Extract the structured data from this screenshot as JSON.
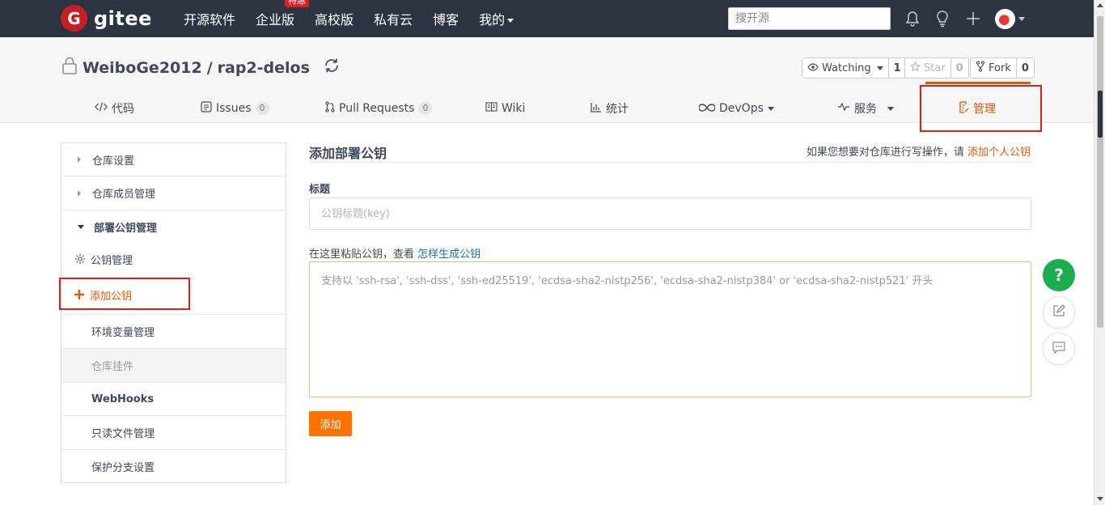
{
  "topnav": {
    "logo_letter": "G",
    "logo_text": "gitee",
    "items": [
      {
        "label": "开源软件"
      },
      {
        "label": "企业版",
        "badge": "特惠"
      },
      {
        "label": "高校版"
      },
      {
        "label": "私有云"
      },
      {
        "label": "博客"
      },
      {
        "label": "我的"
      }
    ],
    "search_placeholder": "搜开源",
    "icons": [
      "bell-icon",
      "lightbulb-icon",
      "plus-icon",
      "avatar"
    ]
  },
  "repo": {
    "owner": "WeiboGe2012",
    "separator": "/",
    "name": "rap2-delos",
    "watch": {
      "label": "Watching",
      "count": "1"
    },
    "star": {
      "label": "Star",
      "count": "0"
    },
    "fork": {
      "label": "Fork",
      "count": "0"
    }
  },
  "tabs": [
    {
      "label": "代码"
    },
    {
      "label": "Issues",
      "count": "0"
    },
    {
      "label": "Pull Requests",
      "count": "0"
    },
    {
      "label": "Wiki"
    },
    {
      "label": "统计"
    },
    {
      "label": "DevOps"
    },
    {
      "label": "服务"
    },
    {
      "label": "管理"
    }
  ],
  "sidebar": {
    "items": [
      {
        "label": "仓库设置"
      },
      {
        "label": "仓库成员管理"
      },
      {
        "label": "部署公钥管理"
      },
      {
        "label": "公钥管理"
      },
      {
        "label": "添加公钥"
      },
      {
        "label": "环境变量管理"
      },
      {
        "label": "仓库挂件"
      },
      {
        "label": "WebHooks"
      },
      {
        "label": "只读文件管理"
      },
      {
        "label": "保护分支设置"
      }
    ]
  },
  "main": {
    "title": "添加部署公钥",
    "hint_text": "如果您想要对仓库进行写操作，请",
    "hint_link": "添加个人公钥",
    "title_label": "标题",
    "title_placeholder": "公钥标题(key)",
    "key_label": "在这里粘贴公钥，查看",
    "key_link": "怎样生成公钥",
    "key_placeholder": "支持以 'ssh-rsa', 'ssh-dss', 'ssh-ed25519', 'ecdsa-sha2-nistp256', 'ecdsa-sha2-nistp384' or 'ecdsa-sha2-nistp521' 开头",
    "submit_label": "添加"
  },
  "floating": {
    "help_label": "?"
  },
  "colors": {
    "nav_bg": "#2d3441",
    "accent": "#da5a0a",
    "button": "#fe7300",
    "help_green": "#1bad4e",
    "highlight_red": "#e02020"
  }
}
